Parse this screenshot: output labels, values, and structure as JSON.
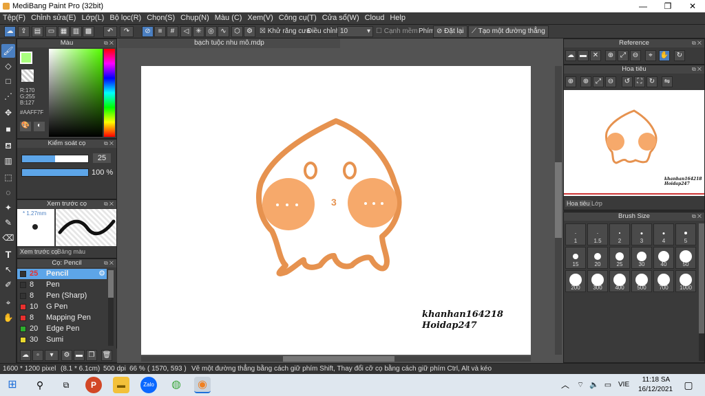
{
  "window": {
    "title": "MediBang Paint Pro (32bit)",
    "min": "—",
    "max": "❐",
    "close": "✕"
  },
  "menu": [
    "Tệp(F)",
    "Chỉnh sửa(E)",
    "Lớp(L)",
    "Bộ lọc(R)",
    "Chọn(S)",
    "Chụp(N)",
    "Màu (C)",
    "Xem(V)",
    "Công cụ(T)",
    "Cửa sổ(W)",
    "Cloud",
    "Help"
  ],
  "toolbar": {
    "antialias_label": "Khử răng cưa",
    "adjust_label": "Điều chỉnh",
    "adjust_value": "10",
    "edge_label": "Cạnh mềm",
    "key_label": "Phím",
    "reset_label": "Đặt lại",
    "line_label": "Tạo một đường thẳng"
  },
  "color_panel": {
    "title": "Màu",
    "r": "R:170",
    "g": "G:255",
    "b": "B:127",
    "hex": "#AAFF7F",
    "fg": "#aaff7f"
  },
  "brush_control": {
    "title": "Kiểm soát cọ",
    "size": "25",
    "opacity": "100 %",
    "size_fraction": 0.5,
    "opacity_fraction": 1.0
  },
  "brush_preview": {
    "title": "Xem trước cọ",
    "size_label": "* 1.27mm",
    "tab1": "Xem trước cọ",
    "tab2": "Bảng màu"
  },
  "brush_list": {
    "title": "Cọ: Pencil",
    "items": [
      {
        "num": "25",
        "name": "Pencil",
        "color": "#333333",
        "selected": true
      },
      {
        "num": "8",
        "name": "Pen",
        "color": "#333333"
      },
      {
        "num": "8",
        "name": "Pen (Sharp)",
        "color": "#333333"
      },
      {
        "num": "10",
        "name": "G Pen",
        "color": "#e8302e"
      },
      {
        "num": "8",
        "name": "Mapping Pen",
        "color": "#e8302e"
      },
      {
        "num": "20",
        "name": "Edge Pen",
        "color": "#2dae2d"
      },
      {
        "num": "30",
        "name": "Sumi",
        "color": "#e8d82e"
      }
    ]
  },
  "document": {
    "tab": "bạch tuộc nhu mô.mdp",
    "watermark1": "khanhan164218",
    "watermark2": "Hoidap247",
    "mouth": "3"
  },
  "reference": {
    "title": "Reference"
  },
  "navigator": {
    "title": "Hoa tiêu",
    "watermark1": "khanhan164218",
    "watermark2": "Hoidap247",
    "tab1": "Hoa tiêu",
    "tab2": "Lớp"
  },
  "brush_size": {
    "title": "Brush Size",
    "sizes": [
      "1",
      "1.5",
      "2",
      "3",
      "4",
      "5",
      "15",
      "20",
      "25",
      "30",
      "40",
      "50",
      "200",
      "300",
      "400",
      "500",
      "700",
      "1000"
    ]
  },
  "status": {
    "dims": "1600 * 1200 pixel",
    "cm": "(8.1 * 6.1cm)",
    "dpi": "500 dpi",
    "zoom": "66 %",
    "coords": "( 1570, 593 )",
    "hint": "Vẽ một đường thẳng bằng cách giữ phím Shift, Thay đổi cỡ cọ bằng cách giữ phím Ctrl, Alt và kéo"
  },
  "taskbar": {
    "time": "11:18 SA",
    "date": "16/12/2021",
    "lang": "VIE",
    "zalo": "Zalo"
  }
}
